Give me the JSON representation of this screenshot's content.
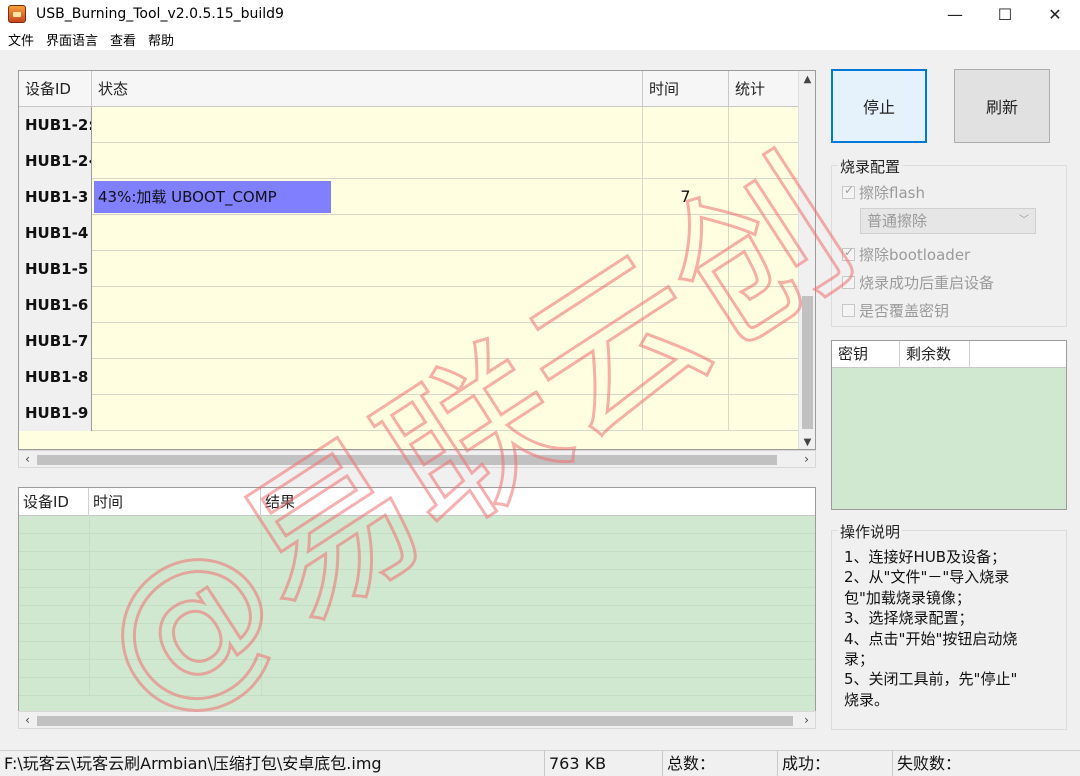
{
  "window": {
    "title": "USB_Burning_Tool_v2.0.5.15_build9",
    "minimize": "—",
    "maximize": "☐",
    "close": "✕"
  },
  "menu": [
    "文件",
    "界面语言",
    "查看",
    "帮助"
  ],
  "device_table": {
    "columns": [
      "设备ID",
      "状态",
      "时间",
      "统计"
    ],
    "rows": [
      {
        "id": "HUB1-2:",
        "status": "",
        "time": "",
        "stat": ""
      },
      {
        "id": "HUB1-2‹",
        "status": "",
        "time": "",
        "stat": ""
      },
      {
        "id": "HUB1-3",
        "status": "43%:加载 UBOOT_COMP",
        "progress": 0.43,
        "time": "7",
        "stat": ""
      },
      {
        "id": "HUB1-4",
        "status": "",
        "time": "",
        "stat": ""
      },
      {
        "id": "HUB1-5",
        "status": "",
        "time": "",
        "stat": ""
      },
      {
        "id": "HUB1-6",
        "status": "",
        "time": "",
        "stat": ""
      },
      {
        "id": "HUB1-7",
        "status": "",
        "time": "",
        "stat": ""
      },
      {
        "id": "HUB1-8",
        "status": "",
        "time": "",
        "stat": ""
      },
      {
        "id": "HUB1-9",
        "status": "",
        "time": "",
        "stat": ""
      }
    ],
    "colors": {
      "background": "#fffee0",
      "progress": "#8080ff"
    }
  },
  "log_table": {
    "columns": [
      "设备ID",
      "时间",
      "结果"
    ],
    "background": "#d0e8d0"
  },
  "buttons": {
    "stop": "停止",
    "refresh": "刷新"
  },
  "burn_config": {
    "title": "烧录配置",
    "erase_flash": "擦除flash",
    "erase_mode": "普通擦除",
    "erase_bootloader": "擦除bootloader",
    "reboot_after": "烧录成功后重启设备",
    "overwrite_key": "是否覆盖密钥"
  },
  "key_table": {
    "columns": [
      "密钥",
      "剩余数"
    ]
  },
  "help": {
    "title": "操作说明",
    "lines": [
      "1、连接好HUB及设备；",
      "2、从\"文件\"－\"导入烧录",
      "包\"加载烧录镜像；",
      "3、选择烧录配置；",
      "4、点击\"开始\"按钮启动烧",
      "录；",
      "5、关闭工具前，先\"停止\"",
      "烧录。"
    ]
  },
  "statusbar": {
    "path": "F:\\玩客云\\玩客云刷Armbian\\压缩打包\\安卓底包.img",
    "size": "763 KB",
    "total": "总数：",
    "success": "成功：",
    "failed": "失败数："
  },
  "watermark": {
    "text": "@易联云创",
    "color": "#f07070"
  }
}
